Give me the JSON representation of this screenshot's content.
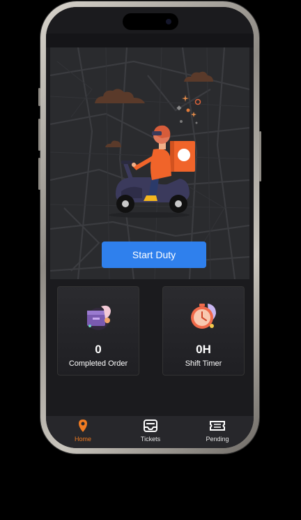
{
  "start_duty": {
    "label": "Start Duty"
  },
  "stats": [
    {
      "value": "0",
      "label": "Completed Order",
      "icon": "box-icon"
    },
    {
      "value": "0H",
      "label": "Shift Timer",
      "icon": "clock-icon"
    }
  ],
  "bottom_nav": [
    {
      "label": "Home",
      "icon": "location-pin-icon",
      "active": true
    },
    {
      "label": "Tickets",
      "icon": "inbox-tray-icon",
      "active": false
    },
    {
      "label": "Pending",
      "icon": "ticket-icon",
      "active": false
    }
  ],
  "colors": {
    "accent": "#f07b22",
    "primary_button": "#2f80ed",
    "background": "#1b1b1e"
  }
}
